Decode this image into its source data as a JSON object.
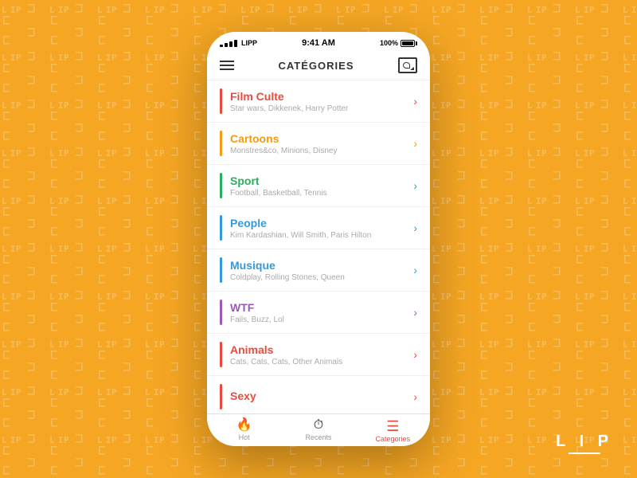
{
  "background": {
    "color": "#F5A623"
  },
  "status_bar": {
    "carrier": "LIPP",
    "time": "9:41 AM",
    "battery": "100%"
  },
  "header": {
    "title": "CATÉGORIES",
    "gallery_label": "gallery"
  },
  "categories": [
    {
      "id": "film-culte",
      "name": "Film Culte",
      "subtitle": "Star wars, Dikkenek, Harry Potter",
      "color": "#e74c3c",
      "chevron_color": "#e74c3c"
    },
    {
      "id": "cartoons",
      "name": "Cartoons",
      "subtitle": "Monstres&co, Minions, Disney",
      "color": "#f39c12",
      "chevron_color": "#f39c12"
    },
    {
      "id": "sport",
      "name": "Sport",
      "subtitle": "Football, Basketball, Tennis",
      "color": "#27ae60",
      "chevron_color": "#27ae60"
    },
    {
      "id": "people",
      "name": "People",
      "subtitle": "Kim Kardashian, Will Smith, Paris Hilton",
      "color": "#3498db",
      "chevron_color": "#3498db"
    },
    {
      "id": "musique",
      "name": "Musique",
      "subtitle": "Coldplay, Rolling Stones, Queen",
      "color": "#3498db",
      "chevron_color": "#3498db"
    },
    {
      "id": "wtf",
      "name": "WTF",
      "subtitle": "Fails, Buzz, Lol",
      "color": "#9b59b6",
      "chevron_color": "#9b59b6"
    },
    {
      "id": "animals",
      "name": "Animals",
      "subtitle": "Cats, Cats, Cats, Other Animals",
      "color": "#e74c3c",
      "chevron_color": "#e74c3c"
    },
    {
      "id": "sexy",
      "name": "Sexy",
      "subtitle": "",
      "color": "#e74c3c",
      "chevron_color": "#e74c3c"
    }
  ],
  "tabs": [
    {
      "id": "hot",
      "label": "Hot",
      "icon": "🔥",
      "active": false
    },
    {
      "id": "recents",
      "label": "Recents",
      "icon": "🕐",
      "active": false
    },
    {
      "id": "categories",
      "label": "Categories",
      "icon": "≡",
      "active": true
    }
  ],
  "lip_logo": {
    "text": "L I P",
    "line": true
  }
}
